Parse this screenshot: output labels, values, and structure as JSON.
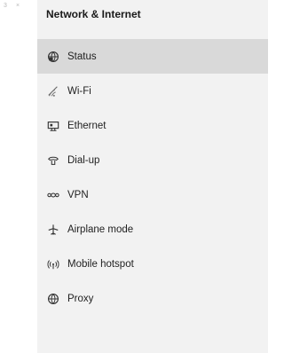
{
  "window": {
    "title": "Network & Internet"
  },
  "nav": {
    "items": [
      {
        "label": "Status",
        "icon": "globe-status-icon",
        "selected": true
      },
      {
        "label": "Wi-Fi",
        "icon": "wifi-icon",
        "selected": false
      },
      {
        "label": "Ethernet",
        "icon": "ethernet-icon",
        "selected": false
      },
      {
        "label": "Dial-up",
        "icon": "dial-up-icon",
        "selected": false
      },
      {
        "label": "VPN",
        "icon": "vpn-icon",
        "selected": false
      },
      {
        "label": "Airplane mode",
        "icon": "airplane-icon",
        "selected": false
      },
      {
        "label": "Mobile hotspot",
        "icon": "mobile-hotspot-icon",
        "selected": false
      },
      {
        "label": "Proxy",
        "icon": "proxy-globe-icon",
        "selected": false
      }
    ]
  },
  "colors": {
    "nav_background": "#f2f2f2",
    "selected_background": "#d9d9d9",
    "text": "#1f1f1f"
  }
}
